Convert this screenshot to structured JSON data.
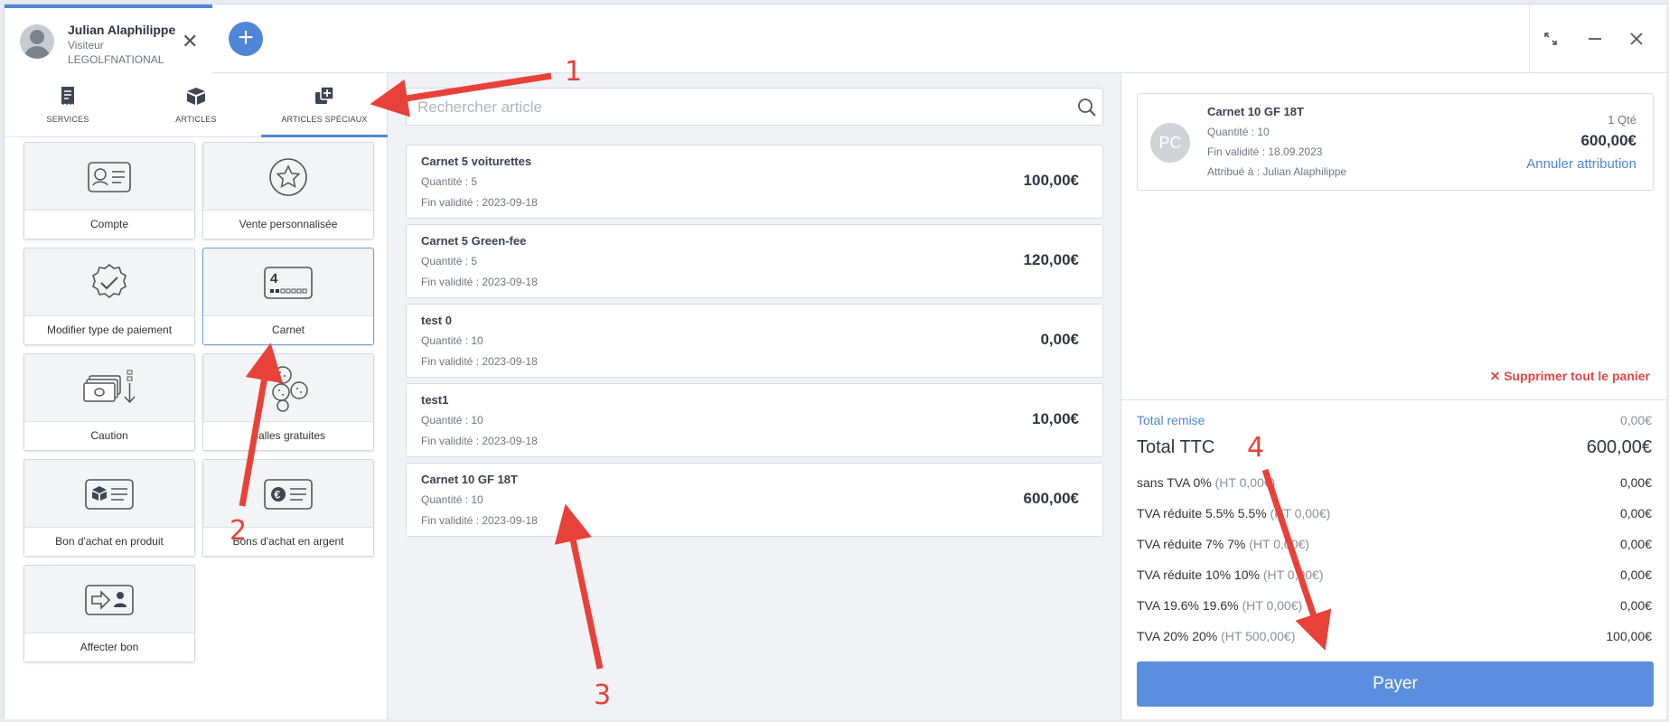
{
  "header": {
    "user_name": "Julian Alaphilippe",
    "user_role": "Visiteur",
    "user_org": "LEGOLFNATIONAL",
    "close_glyph": "✕",
    "add_glyph": "+",
    "ctrl_expand": "⤡",
    "ctrl_minimize": "—",
    "ctrl_close": "✕"
  },
  "tabs": [
    {
      "label": "SERVICES",
      "icon": "receipt-icon"
    },
    {
      "label": "ARTICLES",
      "icon": "box-icon"
    },
    {
      "label": "ARTICLES SPÉCIAUX",
      "icon": "copy-plus-icon",
      "active": true
    }
  ],
  "tiles": [
    {
      "label": "Compte",
      "icon": "id-card-icon"
    },
    {
      "label": "Vente personnalisée",
      "icon": "star-circle-icon"
    },
    {
      "label": "Modifier type de paiement",
      "icon": "badge-check-icon"
    },
    {
      "label": "Carnet",
      "icon": "ticket-book-icon",
      "selected": true,
      "icon_text": "4"
    },
    {
      "label": "Caution",
      "icon": "cash-stack-icon"
    },
    {
      "label": "Balles gratuites",
      "icon": "golf-balls-icon"
    },
    {
      "label": "Bon d'achat en produit",
      "icon": "gift-card-icon"
    },
    {
      "label": "Bons d'achat en argent",
      "icon": "euro-card-icon",
      "icon_text": "€"
    },
    {
      "label": "Affecter bon",
      "icon": "assign-voucher-icon"
    }
  ],
  "search": {
    "placeholder": "Rechercher article"
  },
  "items": [
    {
      "name": "Carnet 5 voiturettes",
      "qty": "Quantité : 5",
      "validity": "Fin validité : 2023-09-18",
      "price": "100,00€"
    },
    {
      "name": "Carnet 5 Green-fee",
      "qty": "Quantité : 5",
      "validity": "Fin validité : 2023-09-18",
      "price": "120,00€"
    },
    {
      "name": "test 0",
      "qty": "Quantité : 10",
      "validity": "Fin validité : 2023-09-18",
      "price": "0,00€"
    },
    {
      "name": "test1",
      "qty": "Quantité : 10",
      "validity": "Fin validité : 2023-09-18",
      "price": "10,00€"
    },
    {
      "name": "Carnet 10 GF 18T",
      "qty": "Quantité : 10",
      "validity": "Fin validité : 2023-09-18",
      "price": "600,00€"
    }
  ],
  "cart": {
    "initials": "PC",
    "name": "Carnet 10 GF 18T",
    "qty": "Quantité : 10",
    "validity": "Fin validité : 18.09.2023",
    "assigned": "Attribué à : Julian Alaphilippe",
    "qty_right": "1 Qté",
    "price": "600,00€",
    "cancel_label": "Annuler attribution",
    "clear_label": "✕ Supprimer tout le panier"
  },
  "totals": {
    "remise_label": "Total remise",
    "remise_value": "0,00€",
    "ttc_label": "Total TTC",
    "ttc_value": "600,00€",
    "taxes": [
      {
        "label": "sans TVA 0%",
        "ht": "(HT 0,00€)",
        "value": "0,00€"
      },
      {
        "label": "TVA réduite 5.5% 5.5%",
        "ht": "(HT 0,00€)",
        "value": "0,00€"
      },
      {
        "label": "TVA réduite 7% 7%",
        "ht": "(HT 0,00€)",
        "value": "0,00€"
      },
      {
        "label": "TVA réduite 10% 10%",
        "ht": "(HT 0,00€)",
        "value": "0,00€"
      },
      {
        "label": "TVA 19.6% 19.6%",
        "ht": "(HT 0,00€)",
        "value": "0,00€"
      },
      {
        "label": "TVA 20% 20%",
        "ht": "(HT 500,00€)",
        "value": "100,00€"
      }
    ],
    "pay_label": "Payer"
  },
  "annotations": [
    "1",
    "2",
    "3",
    "4"
  ],
  "colors": {
    "accent": "#4f86d9",
    "danger": "#e04848",
    "arrow": "#e8413a"
  }
}
